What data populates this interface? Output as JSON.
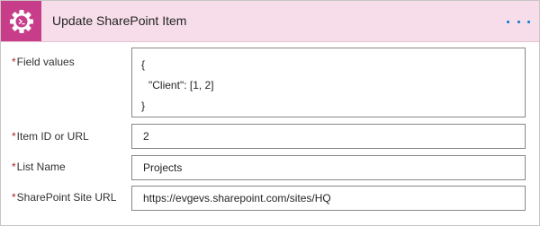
{
  "action": {
    "title": "Update SharePoint Item",
    "icon": "gear-terminal-icon",
    "accent": "#c73d8a",
    "header_bg": "#f6dde9"
  },
  "fields": [
    {
      "label": "Field values",
      "required": "*",
      "lines": [
        "{",
        "\"Client\": [1, 2]",
        "}"
      ]
    },
    {
      "label": "Item ID or URL",
      "required": "*",
      "value": "2"
    },
    {
      "label": "List Name",
      "required": "*",
      "value": "Projects"
    },
    {
      "label": "SharePoint Site URL",
      "required": "*",
      "value": "https://evgevs.sharepoint.com/sites/HQ"
    }
  ]
}
